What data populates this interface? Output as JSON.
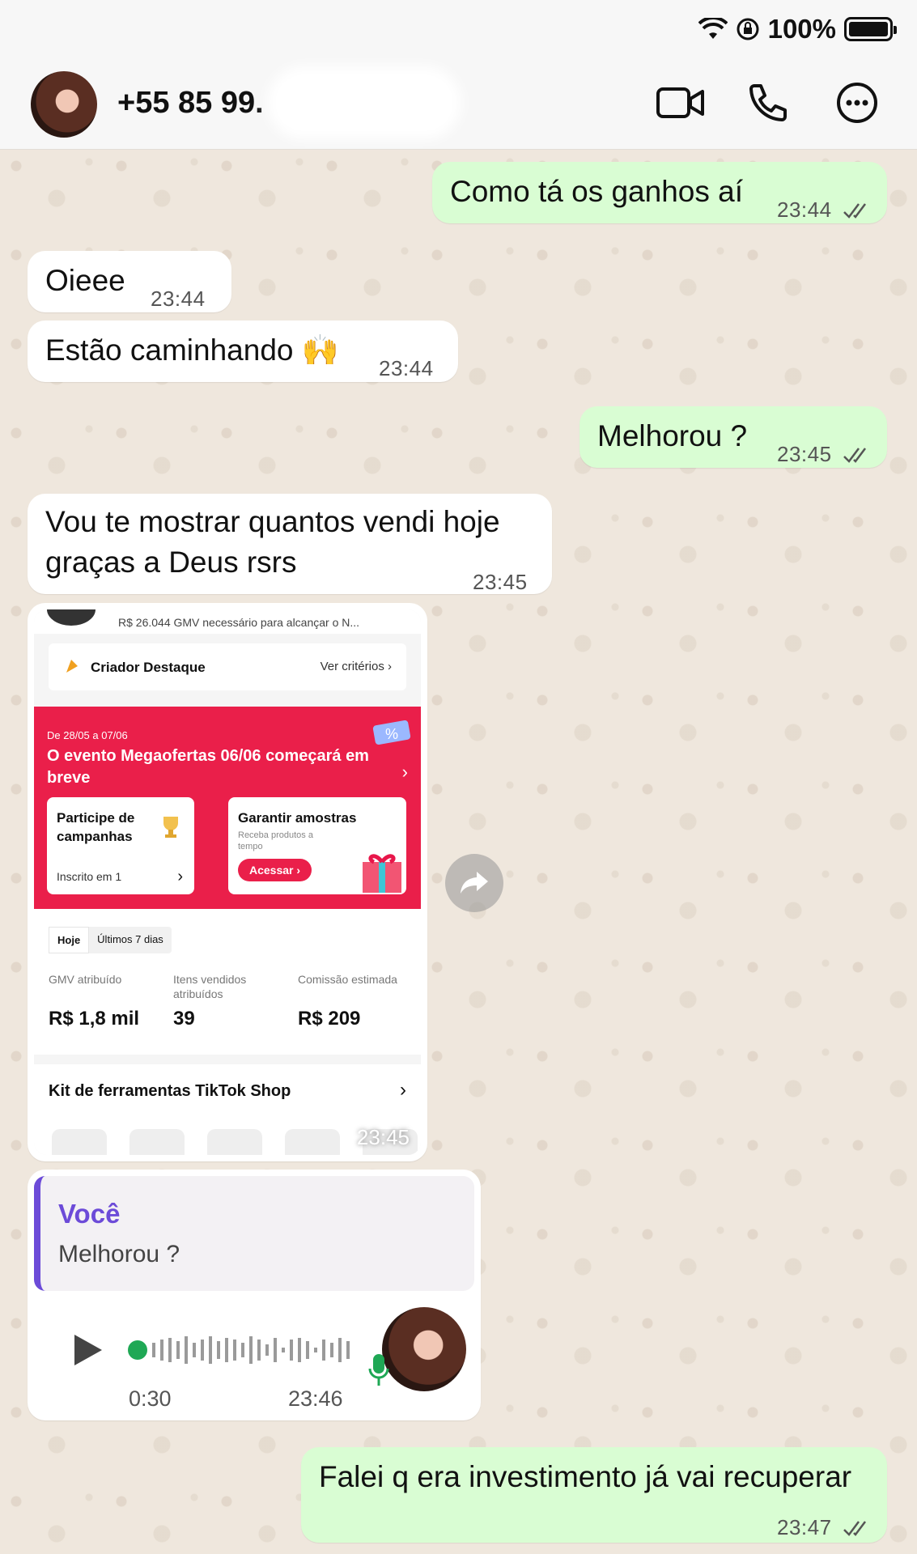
{
  "status_bar": {
    "battery_text": "100%"
  },
  "header": {
    "contact_name": "+55 85 99."
  },
  "messages": {
    "m1": {
      "text": "Como tá os ganhos aí",
      "time": "23:44"
    },
    "m2": {
      "text": "Oieee",
      "time": "23:44"
    },
    "m3": {
      "text": "Estão caminhando 🙌",
      "time": "23:44"
    },
    "m4": {
      "text": "Melhorou ?",
      "time": "23:45"
    },
    "m5": {
      "line1": "Vou te mostrar quantos vendi hoje",
      "line2": "graças a Deus rsrs",
      "time": "23:45"
    },
    "m8": {
      "text": "Falei q era investimento já vai recuperar",
      "time": "23:47"
    }
  },
  "media": {
    "time": "23:45",
    "top_text": "R$ 26.044 GMV necessário para alcançar o N...",
    "creator_title": "Criador Destaque",
    "creator_link": "Ver critérios",
    "banner_date": "De 28/05 a 07/06",
    "banner_title": "O evento Megaofertas 06/06 começará em breve",
    "card1_title": "Participe de campanhas",
    "card1_status": "Inscrito em 1",
    "card2_title": "Garantir amostras",
    "card2_sub": "Receba produtos a tempo",
    "card2_button": "Acessar",
    "tab_today": "Hoje",
    "tab_7days": "Últimos 7 dias",
    "stat1_label": "GMV atribuído",
    "stat1_value": "R$ 1,8 mil",
    "stat2_label": "Itens vendidos atribuídos",
    "stat2_value": "39",
    "stat3_label": "Comissão estimada",
    "stat3_value": "R$ 209",
    "kit_title": "Kit de ferramentas TikTok Shop"
  },
  "voice": {
    "quote_author": "Você",
    "quote_text": "Melhorou ?",
    "duration": "0:30",
    "time": "23:46"
  },
  "colors": {
    "outgoing": "#d9fdd3",
    "incoming": "#ffffff",
    "quote_accent": "#6c4bd8",
    "tiktok_red": "#ea1f4a"
  }
}
